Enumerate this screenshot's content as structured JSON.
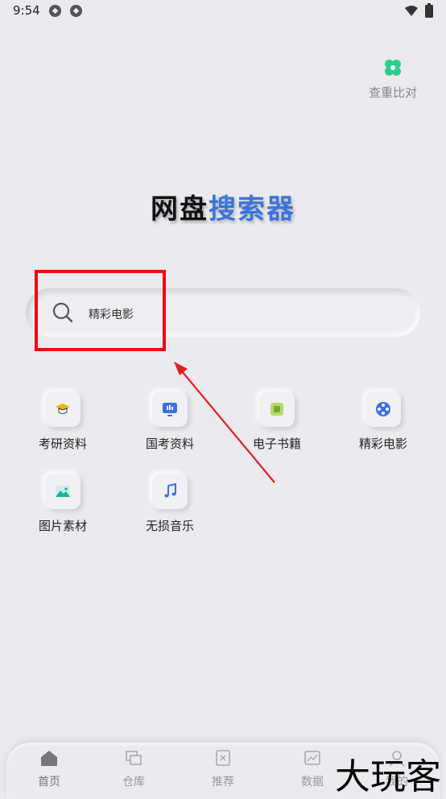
{
  "status_bar": {
    "time": "9:54"
  },
  "compare": {
    "label": "查重比对"
  },
  "title": {
    "part1": "网盘",
    "part2": "搜索器"
  },
  "search": {
    "text": "精彩电影"
  },
  "categories": [
    {
      "label": "考研资料",
      "icon": "graduation-cap-icon"
    },
    {
      "label": "国考资料",
      "icon": "presentation-icon"
    },
    {
      "label": "电子书籍",
      "icon": "ebook-icon"
    },
    {
      "label": "精彩电影",
      "icon": "film-reel-icon"
    },
    {
      "label": "图片素材",
      "icon": "image-icon"
    },
    {
      "label": "无损音乐",
      "icon": "music-note-icon"
    }
  ],
  "bottom_nav": [
    {
      "label": "首页",
      "icon": "home-icon",
      "active": true
    },
    {
      "label": "仓库",
      "icon": "warehouse-icon"
    },
    {
      "label": "推荐",
      "icon": "recommend-icon"
    },
    {
      "label": "数据",
      "icon": "data-icon"
    },
    {
      "label": "我的",
      "icon": "profile-icon"
    }
  ],
  "watermark": "大玩客",
  "colors": {
    "background": "#ebebef",
    "accent": "#3d73dd",
    "highlight": "#ee0a0a",
    "arrow": "#e02020"
  }
}
